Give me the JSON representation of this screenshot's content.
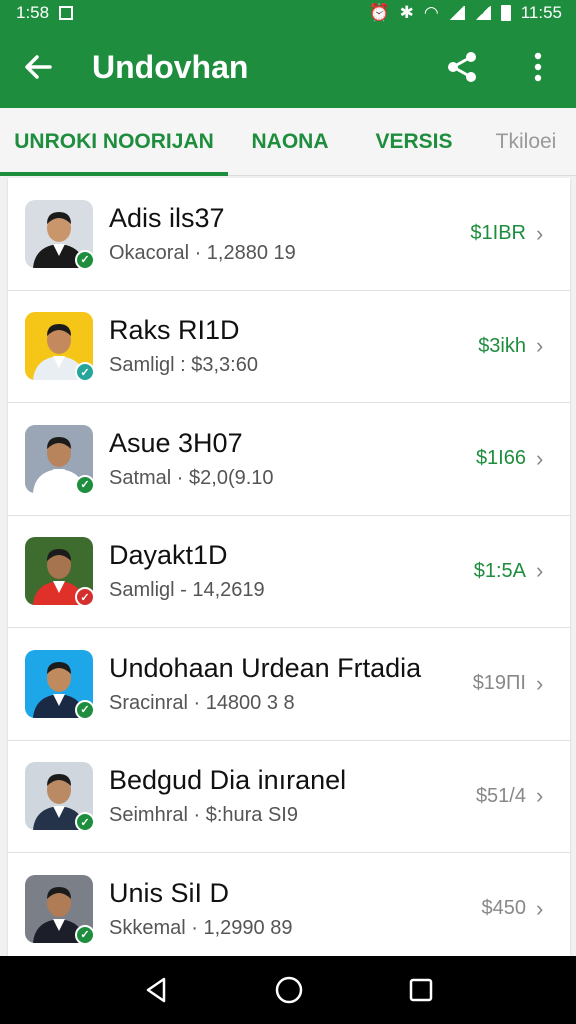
{
  "status_bar": {
    "time_left": "1:58",
    "time_right": "11:55"
  },
  "app_bar": {
    "title": "Undovhan"
  },
  "tabs": [
    {
      "label": "UNROKI NOORIJAN",
      "active": true
    },
    {
      "label": "NAONA",
      "active": false
    },
    {
      "label": "VERSIS",
      "active": false
    },
    {
      "label": "Tkiloei",
      "active": false
    }
  ],
  "list": [
    {
      "name": "Adis ils37",
      "sub": "Okacoral · 1,2880 19",
      "amount": "$1IBR",
      "amount_color": "#1e8e3e",
      "badge_color": "#1e8e3e",
      "avatar_bg": "#d8dde3",
      "shirt": "#1a1a1a",
      "head": "#c9966b"
    },
    {
      "name": "Raks RI1D",
      "sub": "Samligl : $3,3:60",
      "amount": "$3ikh",
      "amount_color": "#1e8e3e",
      "badge_color": "#26a69a",
      "avatar_bg": "#f5c518",
      "shirt": "#e8eef2",
      "head": "#c48a5e"
    },
    {
      "name": "Asue 3H07",
      "sub": "Satmal · $2,0(9.10",
      "amount": "$1I66",
      "amount_color": "#1e8e3e",
      "badge_color": "#1e8e3e",
      "avatar_bg": "#9aa5b5",
      "shirt": "#ffffff",
      "head": "#b8845c"
    },
    {
      "name": "Dayakt1D",
      "sub": "Samligl - 14,2619",
      "amount": "$1:5A",
      "amount_color": "#1e8e3e",
      "badge_color": "#d32f2f",
      "avatar_bg": "#3e6b2e",
      "shirt": "#e0302a",
      "head": "#a6744e"
    },
    {
      "name": "Undohaan Urdean Frtadia",
      "sub": "Sracinral · 14800 3 8",
      "amount": "$19ПI",
      "amount_color": "#888888",
      "badge_color": "#1e8e3e",
      "avatar_bg": "#1ea7e8",
      "shirt": "#1a2a44",
      "head": "#c08a5f"
    },
    {
      "name": "Bedgud Dia inıranel",
      "sub": "Seimhral · $:hura SI9",
      "amount": "$51/4",
      "amount_color": "#888888",
      "badge_color": "#1e8e3e",
      "avatar_bg": "#cfd6de",
      "shirt": "#24324a",
      "head": "#b98a63"
    },
    {
      "name": "Unis SiI D",
      "sub": "Skkemal · 1,2990 89",
      "amount": "$450",
      "amount_color": "#888888",
      "badge_color": "#1e8e3e",
      "avatar_bg": "#7a7f88",
      "shirt": "#1c1f2a",
      "head": "#b07c55"
    }
  ],
  "icons": {
    "back": "arrow-left-icon",
    "share": "share-icon",
    "more": "more-vert-icon",
    "nav_back": "triangle-back-icon",
    "nav_home": "circle-home-icon",
    "nav_recent": "square-recents-icon"
  }
}
